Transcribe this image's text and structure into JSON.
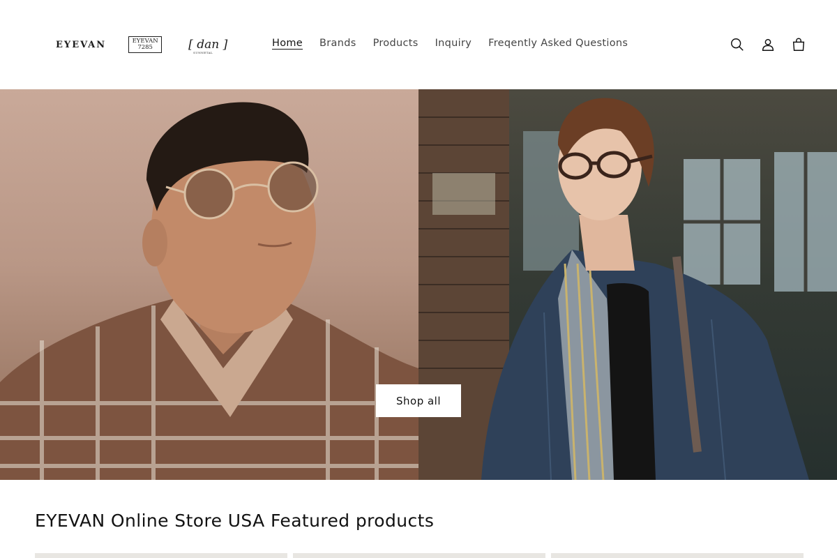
{
  "header": {
    "logos": {
      "eyevan": "EYEVAN",
      "eyevan7285_top": "EYEVAN",
      "eyevan7285_bottom": "7285",
      "dan": "[ dan ]",
      "dan_sub": "SUNNETAL"
    },
    "nav": [
      {
        "label": "Home",
        "active": true
      },
      {
        "label": "Brands"
      },
      {
        "label": "Products"
      },
      {
        "label": "Inquiry"
      },
      {
        "label": "Freqently Asked Questions"
      }
    ],
    "icons": [
      "search-icon",
      "account-icon",
      "cart-icon"
    ]
  },
  "hero": {
    "button_label": "Shop all"
  },
  "featured": {
    "title": "EYEVAN Online Store USA Featured products"
  },
  "colors": {
    "text": "#121212",
    "hero_left_bg": "#b99786",
    "hero_right_bg": "#343a34",
    "button_bg": "#ffffff"
  }
}
